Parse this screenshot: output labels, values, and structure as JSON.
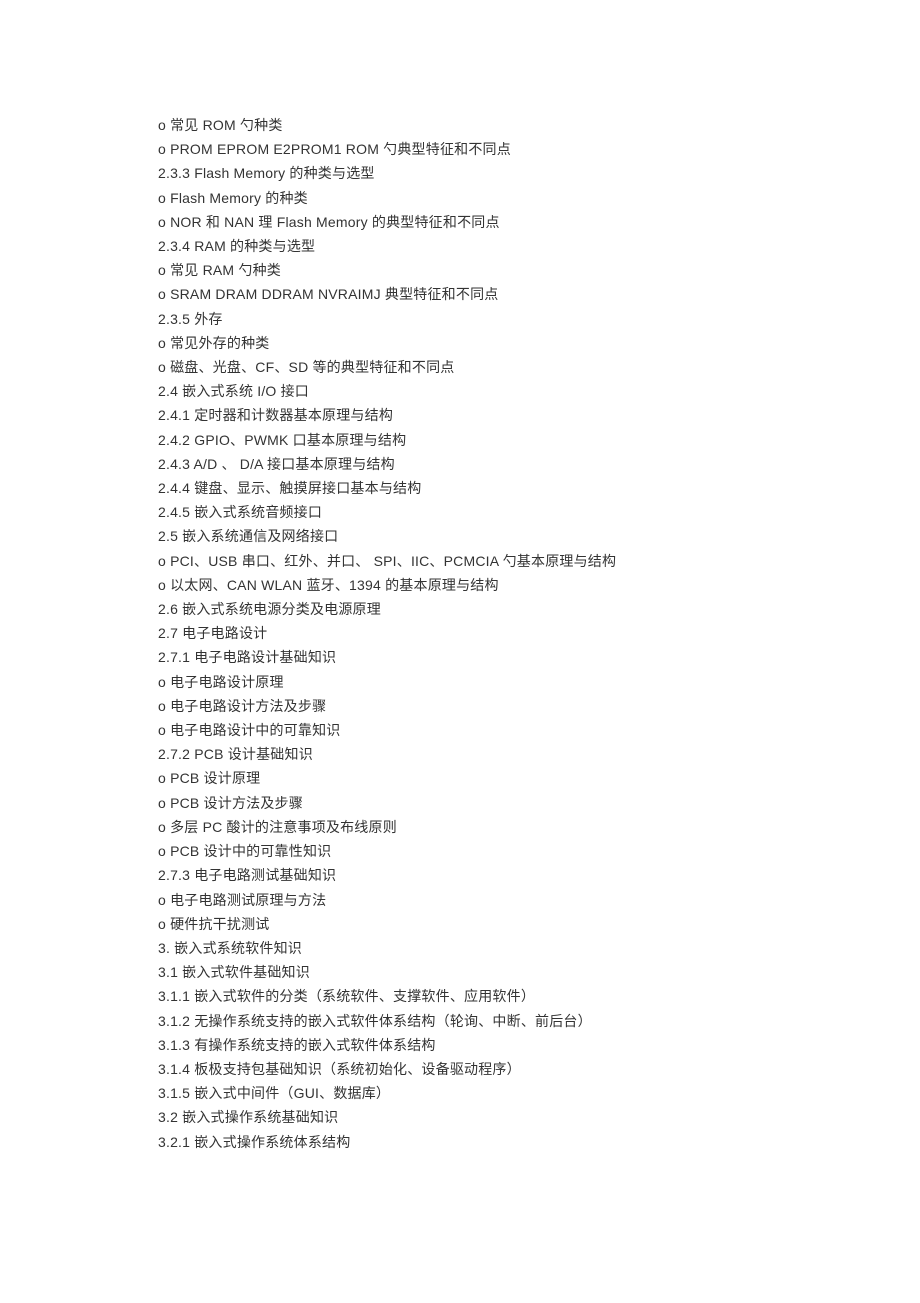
{
  "lines": [
    "o 常见 ROM 勺种类",
    "o PROM EPROM E2PROM1 ROM 勺典型特征和不同点",
    "2.3.3   Flash Memory 的种类与选型",
    "o Flash Memory 的种类",
    "o NOR 和 NAN 理  Flash Memory 的典型特征和不同点",
    "2.3.4    RAM 的种类与选型",
    "o 常见 RAM 勺种类",
    "o SRAM DRAM DDRAM NVRAIMJ 典型特征和不同点",
    "2.3.5   外存",
    "o 常见外存的种类",
    "o 磁盘、光盘、CF、SD 等的典型特征和不同点",
    "2.4  嵌入式系统   I/O 接口",
    "2.4.1   定时器和计数器基本原理与结构",
    "2.4.2   GPIO、PWMK 口基本原理与结构",
    "2.4.3   A/D 、  D/A 接口基本原理与结构",
    "2.4.4   键盘、显示、触摸屏接口基本与结构",
    "2.4.5   嵌入式系统音频接口",
    "2.5  嵌入系统通信及网络接口",
    "o PCI、USB 串口、红外、并口、 SPI、IIC、PCMCIA 勺基本原理与结构",
    "o 以太网、CAN WLAN 蓝牙、1394 的基本原理与结构",
    "2.6  嵌入式系统电源分类及电源原理",
    "2.7  电子电路设计",
    "2.7.1   电子电路设计基础知识",
    "o 电子电路设计原理",
    "o 电子电路设计方法及步骤",
    "o 电子电路设计中的可靠知识",
    "2.7.2   PCB 设计基础知识",
    "o PCB 设计原理",
    "o PCB 设计方法及步骤",
    "o 多层 PC 酸计的注意事项及布线原则",
    "o PCB 设计中的可靠性知识",
    "2.7.3   电子电路测试基础知识",
    "o 电子电路测试原理与方法",
    "o 硬件抗干扰测试",
    "3.  嵌入式系统软件知识",
    "3.1  嵌入式软件基础知识",
    "3.1.1   嵌入式软件的分类（系统软件、支撑软件、应用软件）",
    "3.1.2   无操作系统支持的嵌入式软件体系结构（轮询、中断、前后台）",
    "3.1.3   有操作系统支持的嵌入式软件体系结构",
    "3.1.4   板极支持包基础知识（系统初始化、设备驱动程序）",
    "3.1.5   嵌入式中间件（GUI、数据库）",
    "3.2  嵌入式操作系统基础知识",
    "3.2.1   嵌入式操作系统体系结构"
  ]
}
